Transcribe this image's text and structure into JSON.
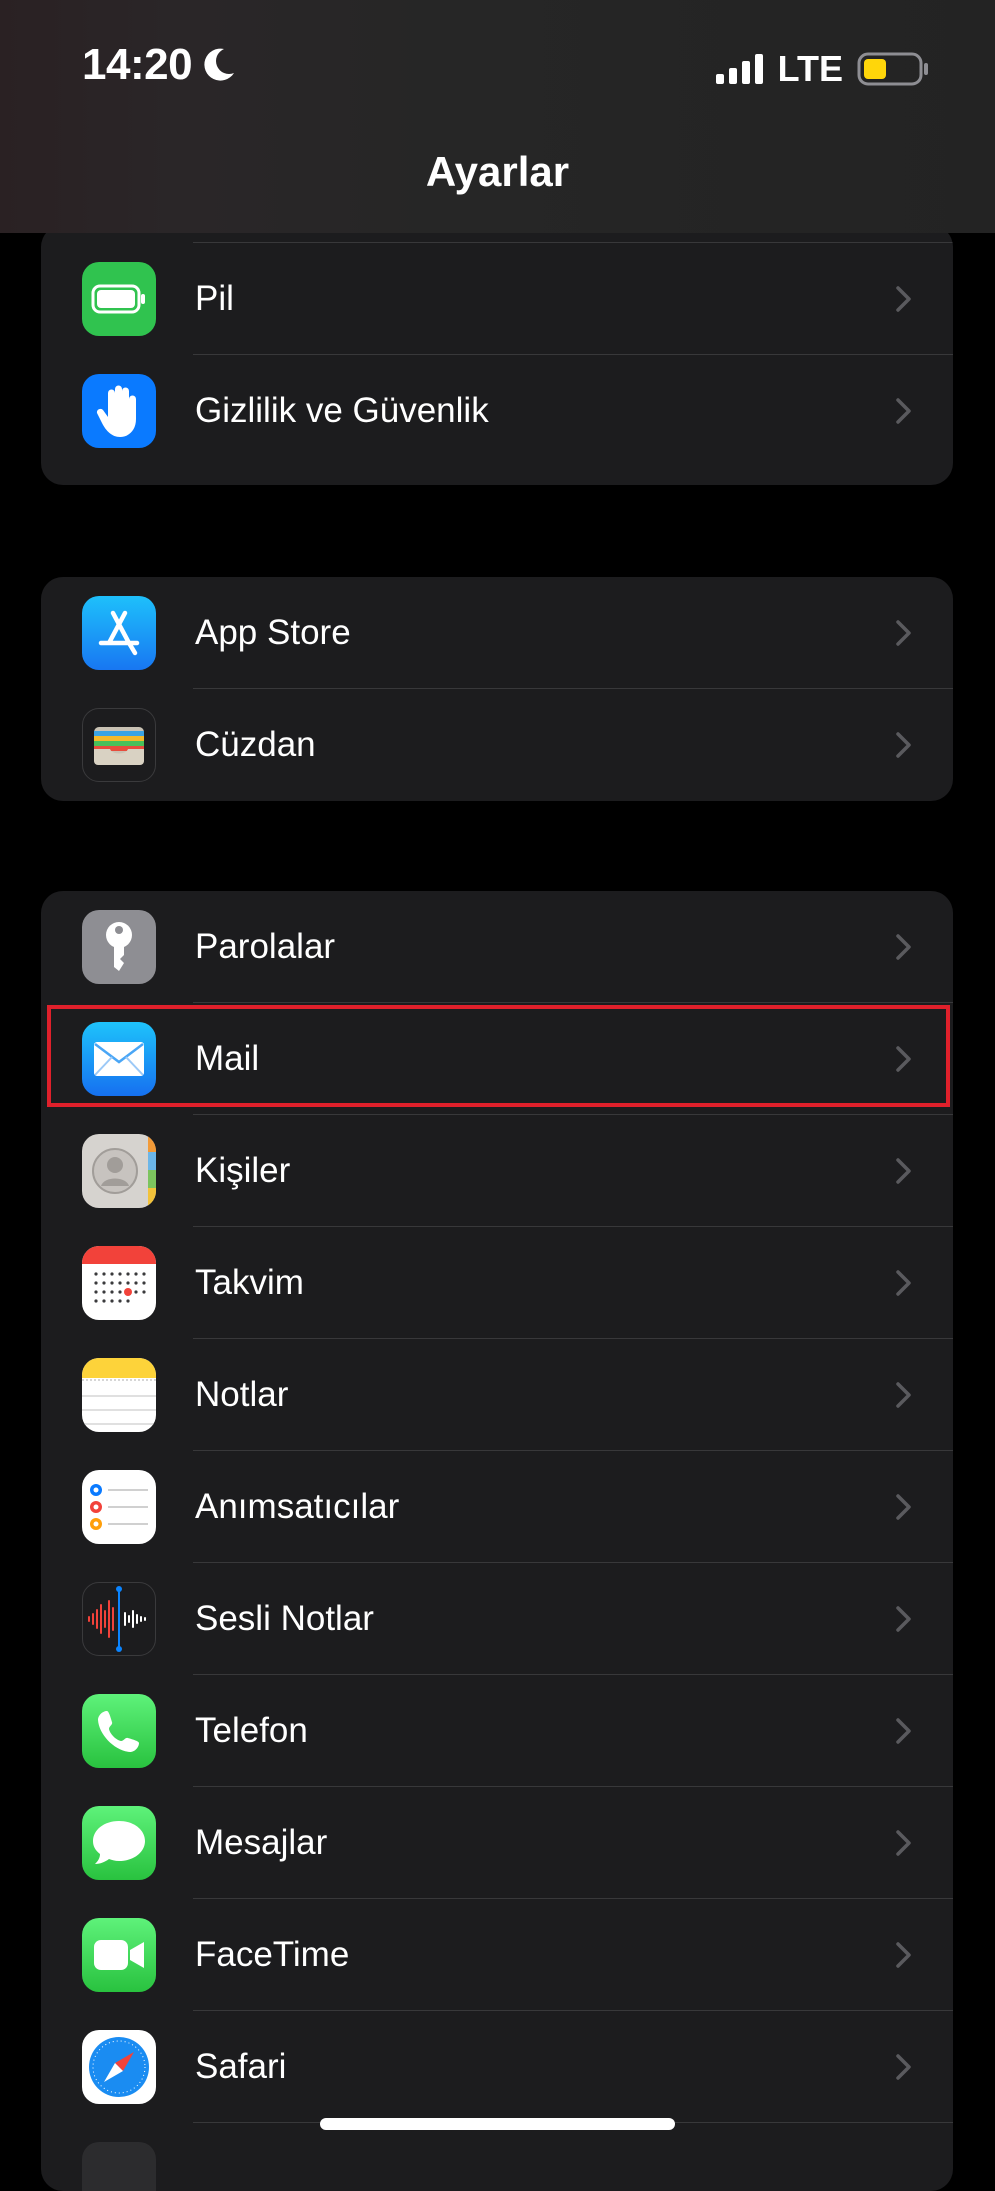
{
  "status_bar": {
    "time": "14:20",
    "network": "LTE"
  },
  "nav": {
    "title": "Ayarlar"
  },
  "groups": [
    {
      "items": [
        {
          "label": "Pil",
          "icon": "battery-icon"
        },
        {
          "label": "Gizlilik ve Güvenlik",
          "icon": "hand-icon"
        }
      ]
    },
    {
      "items": [
        {
          "label": "App Store",
          "icon": "app-store-icon"
        },
        {
          "label": "Cüzdan",
          "icon": "wallet-icon"
        }
      ]
    },
    {
      "items": [
        {
          "label": "Parolalar",
          "icon": "key-icon"
        },
        {
          "label": "Mail",
          "icon": "mail-icon"
        },
        {
          "label": "Kişiler",
          "icon": "contacts-icon"
        },
        {
          "label": "Takvim",
          "icon": "calendar-icon"
        },
        {
          "label": "Notlar",
          "icon": "notes-icon"
        },
        {
          "label": "Anımsatıcılar",
          "icon": "reminders-icon"
        },
        {
          "label": "Sesli Notlar",
          "icon": "voice-memos-icon"
        },
        {
          "label": "Telefon",
          "icon": "phone-icon"
        },
        {
          "label": "Mesajlar",
          "icon": "messages-icon"
        },
        {
          "label": "FaceTime",
          "icon": "facetime-icon"
        },
        {
          "label": "Safari",
          "icon": "safari-icon"
        }
      ]
    }
  ],
  "colors": {
    "background": "#000000",
    "group": "#1c1c1e",
    "separator": "#38383a",
    "highlight": "#e0202b",
    "battery_level": "#ffd60a"
  }
}
